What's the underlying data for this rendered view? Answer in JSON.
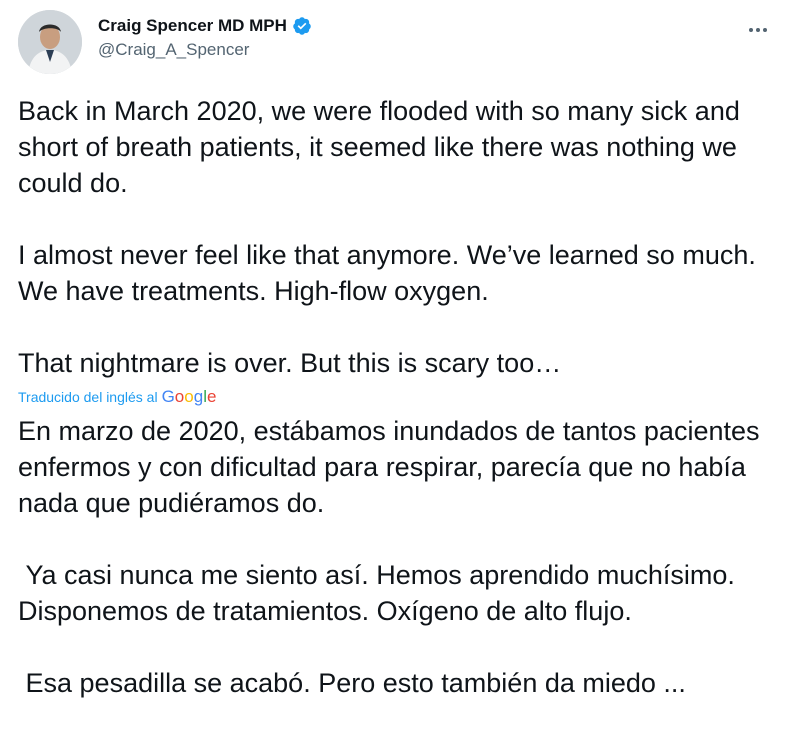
{
  "author": {
    "display_name": "Craig Spencer MD MPH",
    "handle": "@Craig_A_Spencer",
    "verified": true
  },
  "icons": {
    "more": "more-horizontal-icon",
    "verified": "verified-badge-icon"
  },
  "colors": {
    "accent": "#1d9bf0",
    "text": "#0f1419",
    "secondary": "#536471"
  },
  "tweet": {
    "paragraphs": [
      "Back in March 2020, we were flooded with so many sick and short of breath patients, it seemed like there was nothing we could do.",
      "I almost never feel like that anymore. We’ve learned so much. We have treatments. High-flow oxygen.",
      "That nightmare is over. But this is scary too…"
    ]
  },
  "translation": {
    "label": "Traducido del inglés al",
    "provider": "Google",
    "paragraphs": [
      "En marzo de 2020, estábamos inundados de tantos pacientes enfermos y con dificultad para respirar, parecía que no había nada que pudiéramos do.",
      " Ya casi nunca me siento así. Hemos aprendido muchísimo. Disponemos de tratamientos. Oxígeno de alto flujo.",
      " Esa pesadilla se acabó. Pero esto también da miedo ..."
    ]
  }
}
